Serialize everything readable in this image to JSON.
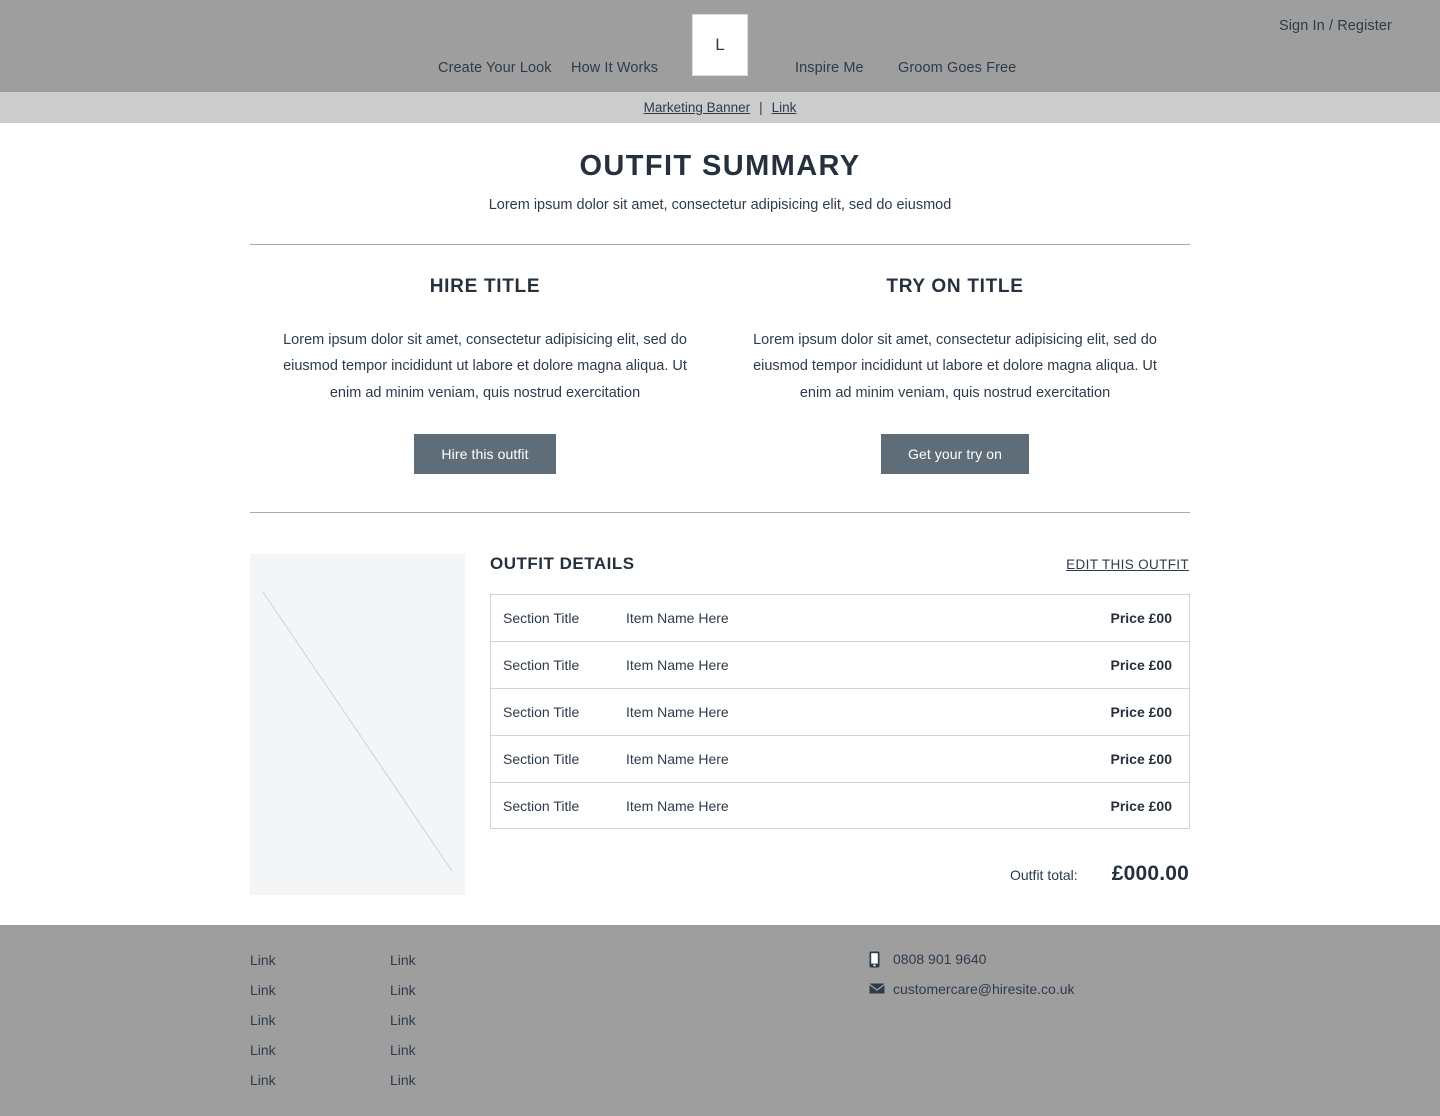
{
  "header": {
    "signin_label": "Sign In / Register",
    "logo_text": "L",
    "nav_items": [
      {
        "label": "Create Your Look"
      },
      {
        "label": "How It Works"
      },
      {
        "label": "Inspire Me"
      },
      {
        "label": "Groom Goes Free"
      }
    ]
  },
  "marketing_banner": {
    "text": "Marketing Banner",
    "separator": "|",
    "link": "Link"
  },
  "main": {
    "title": "OUTFIT SUMMARY",
    "subtitle": "Lorem ipsum dolor sit amet, consectetur adipisicing elit, sed do eiusmod",
    "columns": [
      {
        "title": "HIRE TITLE",
        "body": "Lorem ipsum dolor sit amet, consectetur adipisicing elit, sed do eiusmod tempor incididunt ut labore et dolore magna aliqua. Ut enim ad minim veniam, quis nostrud exercitation",
        "button": "Hire this outfit"
      },
      {
        "title": "TRY ON TITLE",
        "body": "Lorem ipsum dolor sit amet, consectetur adipisicing elit, sed do eiusmod tempor incididunt ut labore et dolore magna aliqua. Ut enim ad minim veniam, quis nostrud exercitation",
        "button": "Get your try on"
      }
    ]
  },
  "details": {
    "title": "OUTFIT DETAILS",
    "edit_link": "EDIT THIS OUTFIT",
    "image_placeholder": "image-placeholder",
    "rows": [
      {
        "section": "Section Title",
        "item": "Item Name Here",
        "price": "Price £00"
      },
      {
        "section": "Section Title",
        "item": "Item Name Here",
        "price": "Price £00"
      },
      {
        "section": "Section Title",
        "item": "Item Name Here",
        "price": "Price £00"
      },
      {
        "section": "Section Title",
        "item": "Item Name Here",
        "price": "Price £00"
      },
      {
        "section": "Section Title",
        "item": "Item Name Here",
        "price": "Price £00"
      }
    ],
    "total_label": "Outfit total:",
    "total_value": "£000.00"
  },
  "footer": {
    "col1": [
      {
        "label": "Link"
      },
      {
        "label": "Link"
      },
      {
        "label": "Link"
      },
      {
        "label": "Link"
      },
      {
        "label": "Link"
      }
    ],
    "col2": [
      {
        "label": "Link"
      },
      {
        "label": "Link"
      },
      {
        "label": "Link"
      },
      {
        "label": "Link"
      },
      {
        "label": "Link"
      }
    ],
    "phone": "0808 901 9640",
    "email": "customercare@hiresite.co.uk",
    "phone_icon": "mobile-phone-icon",
    "email_icon": "envelope-icon"
  },
  "colors": {
    "header_bg": "#9e9e9e",
    "banner_bg": "#cccccc",
    "button_bg": "#5f6d79",
    "text": "#2e3b4a",
    "table_border": "#ccd4dc",
    "placeholder_bg": "#f4f5f6",
    "footer_bg": "#9e9e9e"
  }
}
